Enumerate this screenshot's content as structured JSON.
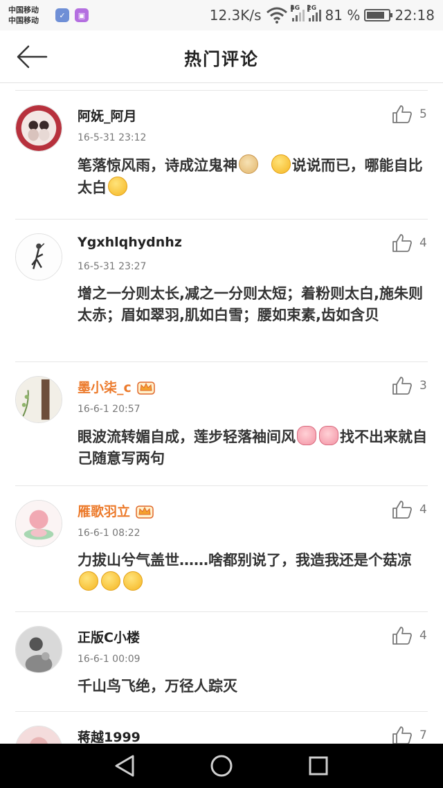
{
  "status_bar": {
    "carrier_1": "中国移动",
    "carrier_2": "中国移动",
    "speed": "12.3K/s",
    "net_4g": "4G",
    "net_2g": "2G",
    "battery_pct": "81 %",
    "battery_level": 0.81,
    "time": "22:18"
  },
  "header": {
    "title": "热门评论"
  },
  "comments": [
    {
      "username": "阿妩_阿月",
      "time": "16-5-31 23:12",
      "likes": "5",
      "vip": false,
      "text_a": "笔落惊风雨，诗成泣鬼神",
      "text_b": "说说而已，哪能自比太白"
    },
    {
      "username": "Ygxhlqhydnhz",
      "time": "16-5-31 23:27",
      "likes": "4",
      "vip": false,
      "text": "增之一分则太长,减之一分则太短；着粉则太白,施朱则太赤；眉如翠羽,肌如白雪；腰如束素,齿如含贝"
    },
    {
      "username": "墨小柒_c",
      "time": "16-6-1 20:57",
      "likes": "3",
      "vip": true,
      "text_a": "眼波流转媚自成，莲步轻落袖间风",
      "text_b": "找不出来就自己随意写两句"
    },
    {
      "username": "雁歌羽立",
      "time": "16-6-1 08:22",
      "likes": "4",
      "vip": true,
      "text": "力拔山兮气盖世……啥都别说了，我造我还是个菇凉"
    },
    {
      "username": "正版C小楼",
      "time": "16-6-1 00:09",
      "likes": "4",
      "vip": false,
      "text": "千山鸟飞绝，万径人踪灭"
    },
    {
      "username": "蒋越1999",
      "likes": "7",
      "vip": false
    }
  ],
  "icons": {
    "back": "arrow-left-icon",
    "like": "thumbs-up-icon",
    "vip": "crown-icon",
    "nav_back": "triangle-back-icon",
    "nav_home": "circle-home-icon",
    "nav_recent": "square-recent-icon"
  },
  "colors": {
    "vip_name": "#ec7a2b",
    "nav_bg": "#000000"
  }
}
